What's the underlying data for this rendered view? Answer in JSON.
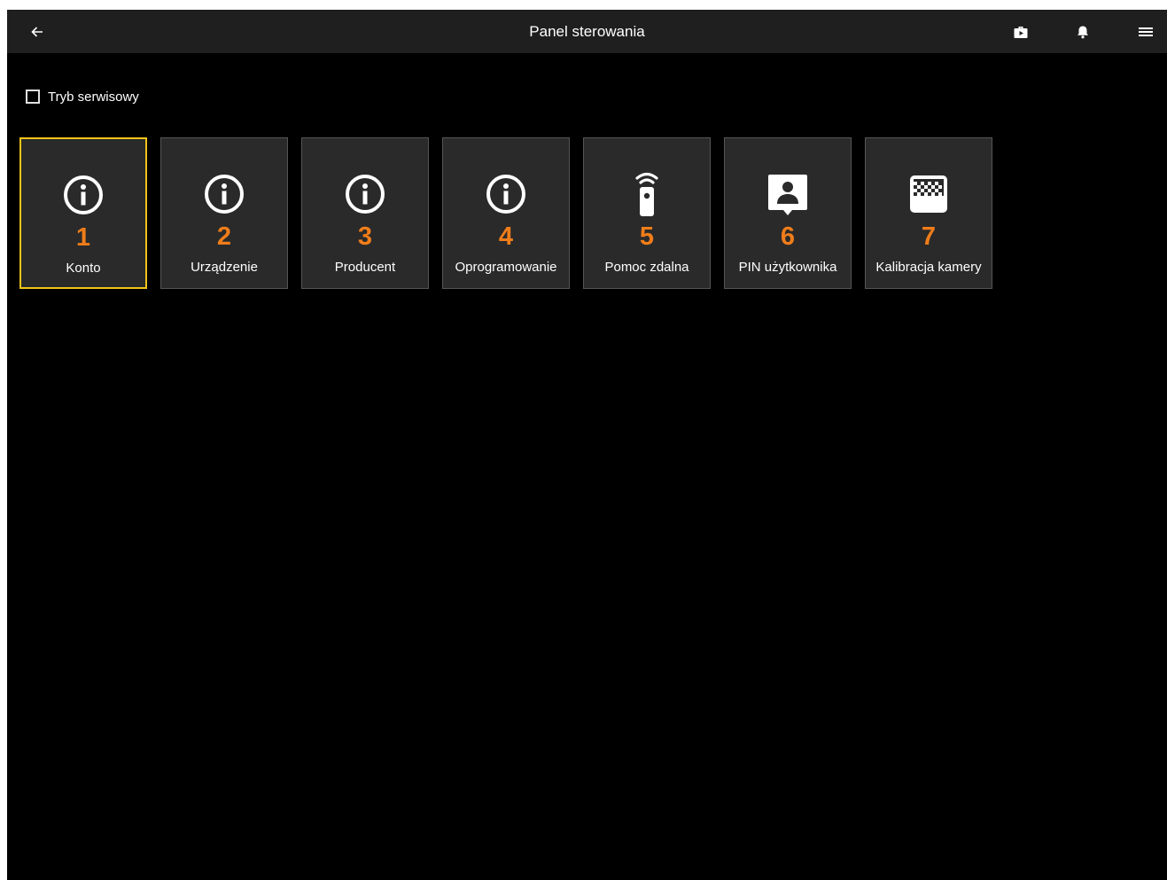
{
  "header": {
    "title": "Panel sterowania",
    "icons": {
      "back": "arrow-left-icon",
      "briefcase": "briefcase-play-icon",
      "notifications": "bell-icon",
      "menu": "hamburger-menu-icon"
    }
  },
  "service_mode": {
    "label": "Tryb serwisowy",
    "checked": false
  },
  "colors": {
    "accent_number": "#f07d1a",
    "selected_border": "#f2c417",
    "tile_background": "#2a2a2a",
    "background": "#000000",
    "titlebar": "#1f1f1f"
  },
  "tiles": [
    {
      "number": "1",
      "label": "Konto",
      "icon": "info-icon",
      "selected": true
    },
    {
      "number": "2",
      "label": "Urządzenie",
      "icon": "info-icon",
      "selected": false
    },
    {
      "number": "3",
      "label": "Producent",
      "icon": "info-icon",
      "selected": false
    },
    {
      "number": "4",
      "label": "Oprogramowanie",
      "icon": "info-icon",
      "selected": false
    },
    {
      "number": "5",
      "label": "Pomoc zdalna",
      "icon": "remote-control-icon",
      "selected": false
    },
    {
      "number": "6",
      "label": "PIN użytkownika",
      "icon": "user-badge-icon",
      "selected": false
    },
    {
      "number": "7",
      "label": "Kalibracja kamery",
      "icon": "camera-calibration-icon",
      "selected": false
    }
  ]
}
